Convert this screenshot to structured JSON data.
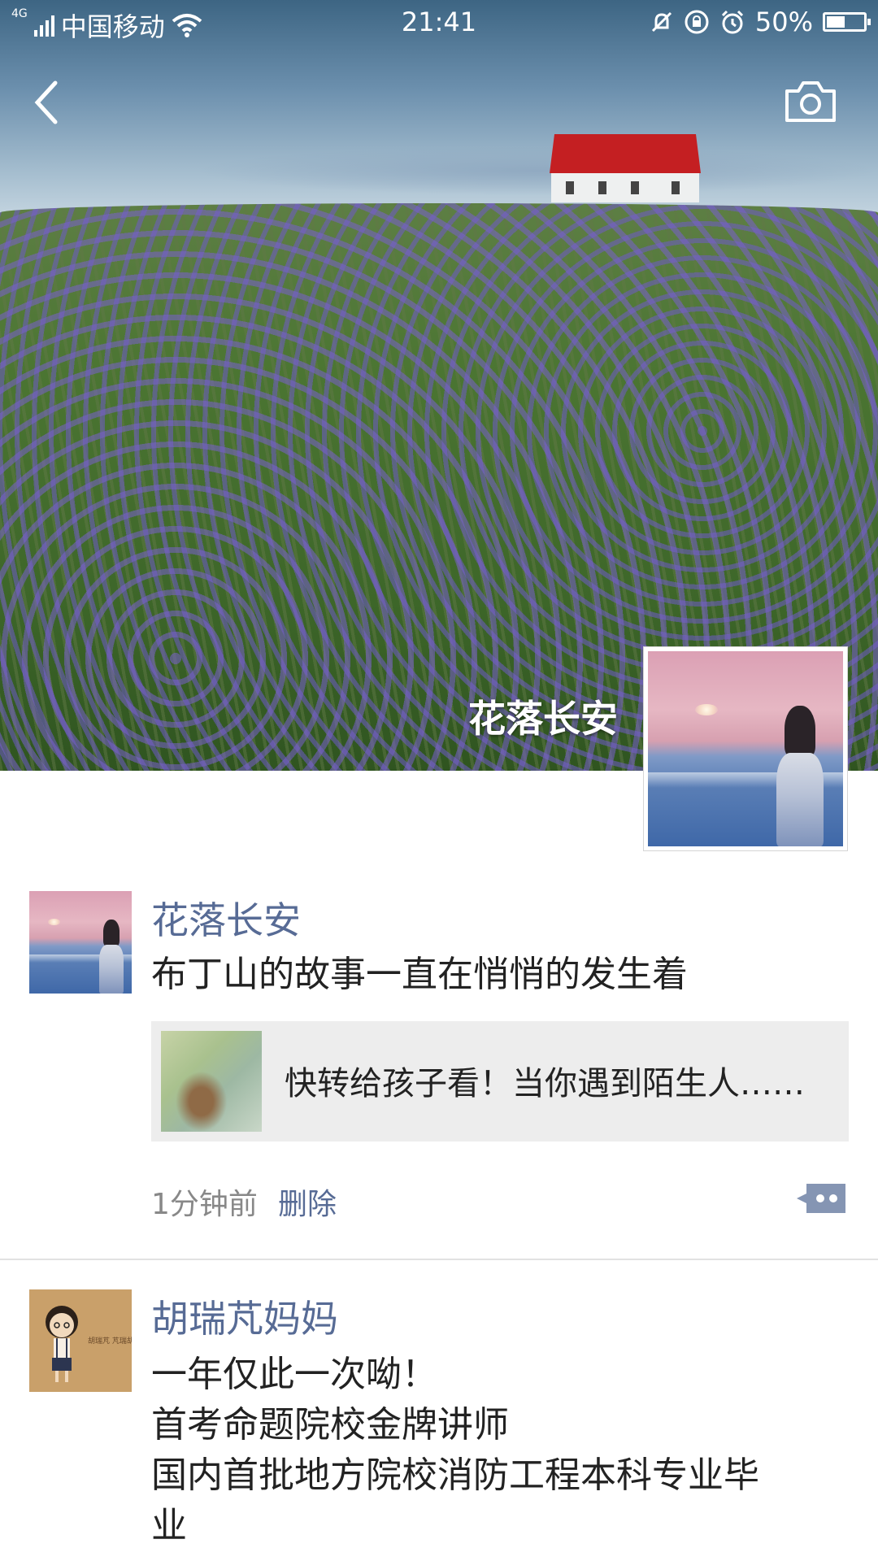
{
  "status_bar": {
    "network": "4G",
    "carrier": "中国移动",
    "time": "21:41",
    "battery": "50%",
    "battery_level": 0.5
  },
  "header": {
    "back_icon": "chevron-left-icon",
    "camera_icon": "camera-icon"
  },
  "cover": {
    "user_name": "花落长安"
  },
  "posts": [
    {
      "name": "花落长安",
      "text": "布丁山的故事一直在悄悄的发生着",
      "link": {
        "title": "快转给孩子看！当你遇到陌生人……"
      },
      "time": "1分钟前",
      "delete_label": "删除"
    },
    {
      "name": "胡瑞芃妈妈",
      "lines": [
        "一年仅此一次呦！",
        "首考命题院校金牌讲师",
        "国内首批地方院校消防工程本科专业毕",
        "业"
      ],
      "avatar_caption": "胡瑞芃 芃瑞胡胡芃"
    }
  ],
  "colors": {
    "name_blue": "#576b95",
    "text": "#222222",
    "muted": "#888888",
    "card_bg": "#ededed"
  }
}
